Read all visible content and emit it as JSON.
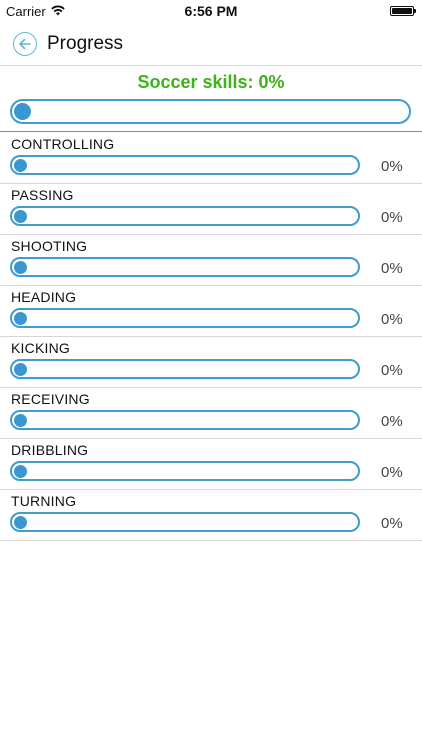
{
  "status_bar": {
    "carrier": "Carrier",
    "time": "6:56 PM"
  },
  "nav": {
    "title": "Progress"
  },
  "overall": {
    "title": "Soccer skills: 0%",
    "progress": 0
  },
  "skills": [
    {
      "label": "CONTROLLING",
      "percent": "0%",
      "progress": 0
    },
    {
      "label": "PASSING",
      "percent": "0%",
      "progress": 0
    },
    {
      "label": "SHOOTING",
      "percent": "0%",
      "progress": 0
    },
    {
      "label": "HEADING",
      "percent": "0%",
      "progress": 0
    },
    {
      "label": "KICKING",
      "percent": "0%",
      "progress": 0
    },
    {
      "label": "RECEIVING",
      "percent": "0%",
      "progress": 0
    },
    {
      "label": "DRIBBLING",
      "percent": "0%",
      "progress": 0
    },
    {
      "label": "TURNING",
      "percent": "0%",
      "progress": 0
    }
  ],
  "colors": {
    "accent": "#3f9ccd",
    "title_green": "#3cb319"
  },
  "icons": {
    "back": "back-arrow-circle-icon",
    "wifi": "wifi-icon",
    "battery": "battery-icon"
  }
}
